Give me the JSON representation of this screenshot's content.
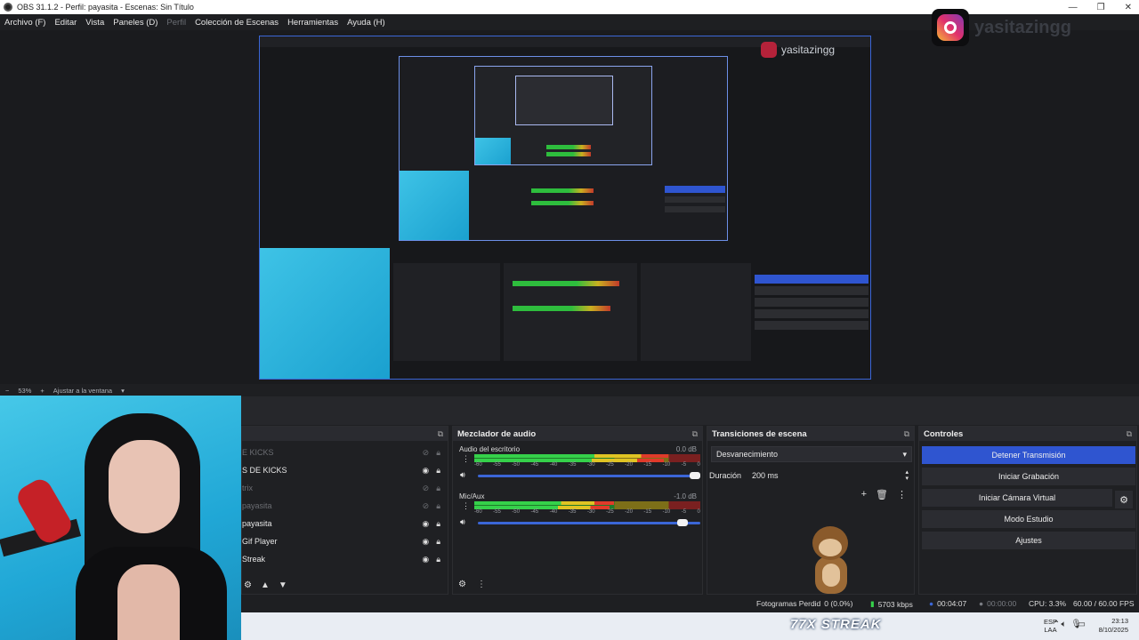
{
  "window": {
    "title": "OBS 31.1.2 - Perfil: payasita - Escenas: Sin Título",
    "controls": [
      "—",
      "❐",
      "✕"
    ]
  },
  "menu": {
    "items": [
      "Archivo (F)",
      "Editar",
      "Vista",
      "Paneles (D)",
      "Perfil",
      "Colección de Escenas",
      "Herramientas",
      "Ayuda (H)"
    ]
  },
  "overlay": {
    "instagram_handle": "yasitazingg",
    "instagram_handle_mini": "yasitazingg",
    "streak": "77X STREAK"
  },
  "zoom": {
    "minus": "−",
    "value": "53%",
    "plus": "+",
    "fit_label": "Ajustar a la ventana",
    "dropdown": "▾"
  },
  "sources": {
    "rows": [
      {
        "name": "E KICKS",
        "dim": true
      },
      {
        "name": "S DE KICKS",
        "dim": false
      },
      {
        "name": "trix",
        "dim": true
      },
      {
        "name": "payasita",
        "dim": true
      },
      {
        "name": "payasita",
        "dim": false
      },
      {
        "name": "Gif Player",
        "dim": false
      },
      {
        "name": "Streak",
        "dim": false
      }
    ],
    "footer": [
      "⚙",
      "▲",
      "▼"
    ]
  },
  "mixer": {
    "title": "Mezclador de audio",
    "scale": [
      "-60",
      "-55",
      "-50",
      "-45",
      "-40",
      "-35",
      "-30",
      "-25",
      "-20",
      "-15",
      "-10",
      "-5",
      "0"
    ],
    "channels": [
      {
        "name": "Audio del escritorio",
        "db": "0.0 dB",
        "level": 0.86,
        "level2": 0.84,
        "volume": 1.0
      },
      {
        "name": "Mic/Aux",
        "db": "-1.0 dB",
        "level": 0.62,
        "level2": 0.6,
        "volume": 0.94
      }
    ]
  },
  "transitions": {
    "title": "Transiciones de escena",
    "selected": "Desvanecimiento",
    "duration_label": "Duración",
    "duration_value": "200 ms"
  },
  "controls": {
    "title": "Controles",
    "stop_stream": "Detener Transmisión",
    "start_record": "Iniciar Grabación",
    "start_vcam": "Iniciar Cámara Virtual",
    "studio_mode": "Modo Estudio",
    "settings": "Ajustes"
  },
  "status": {
    "frames_dropped": "Fotogramas Perdid",
    "frames_pct": "0 (0.0%)",
    "bitrate": "5703 kbps",
    "stream_time": "00:04:07",
    "record_time": "00:00:00",
    "cpu": "CPU: 3.3%",
    "fps": "60.00 / 60.00 FPS"
  },
  "taskbar": {
    "lang_top": "ESP",
    "lang_bottom": "LAA",
    "time": "23:13",
    "date": "8/10/2025"
  },
  "colors": {
    "accent": "#2f55d0",
    "meter_green": "#35d14a",
    "meter_yellow": "#e0c423",
    "meter_red": "#e03a2a"
  }
}
